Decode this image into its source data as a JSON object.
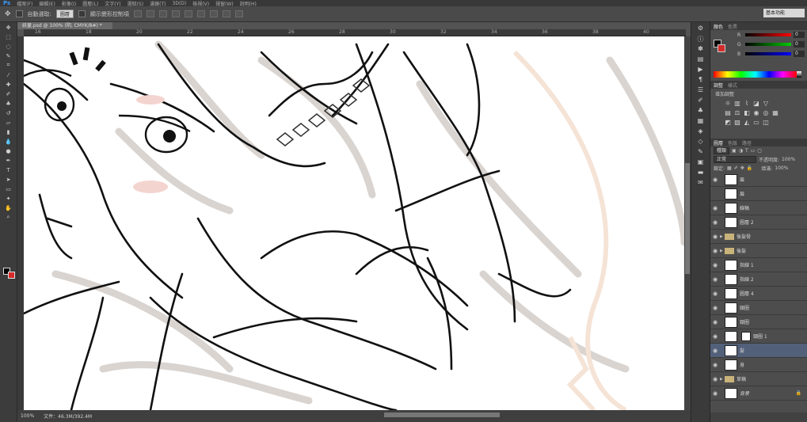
{
  "app": {
    "logo": "Ps"
  },
  "menu": [
    "檔案(F)",
    "編輯(E)",
    "影像(I)",
    "圖層(L)",
    "文字(Y)",
    "選取(S)",
    "濾鏡(T)",
    "3D(D)",
    "檢視(V)",
    "視窗(W)",
    "說明(H)"
  ],
  "options": {
    "auto_select_label": "自動選取:",
    "auto_select_value": "圖層",
    "transform_label": "顯示變形控制項"
  },
  "workspace": {
    "value": "基本功能"
  },
  "document": {
    "tab_title": "妖童.psd @ 100% (阴, CMYK/8#) *",
    "zoom": "100%",
    "status": "文件：46.3M/392.4M"
  },
  "ruler": {
    "labels": [
      "16",
      "18",
      "20",
      "22",
      "24",
      "26",
      "28",
      "30",
      "32",
      "34",
      "36",
      "38",
      "40",
      "42"
    ]
  },
  "color_panel": {
    "tabs": [
      "顏色",
      "色票"
    ],
    "channels": [
      {
        "label": "R",
        "value": "0"
      },
      {
        "label": "G",
        "value": "0"
      },
      {
        "label": "B",
        "value": "0"
      }
    ]
  },
  "adjust_panel": {
    "tabs": [
      "調整",
      "樣式"
    ],
    "title": "增加調整"
  },
  "layers_panel": {
    "tabs": [
      "圖層",
      "色版",
      "路徑"
    ],
    "filter_kind": "種類",
    "blend_mode": "正常",
    "opacity_label": "不透明度:",
    "opacity_value": "100%",
    "lock_label": "鎖定:",
    "fill_label": "填滿:",
    "fill_value": "100%",
    "layers": [
      {
        "name": "眉",
        "kind": "layer"
      },
      {
        "name": "眉",
        "kind": "layer"
      },
      {
        "name": "線稿",
        "kind": "layer"
      },
      {
        "name": "圖層 2",
        "kind": "layer"
      },
      {
        "name": "後髮骨",
        "kind": "group"
      },
      {
        "name": "後髮",
        "kind": "group"
      },
      {
        "name": "指線 1",
        "kind": "layer"
      },
      {
        "name": "指線 2",
        "kind": "layer"
      },
      {
        "name": "圖層 4",
        "kind": "layer"
      },
      {
        "name": "頸圈",
        "kind": "layer"
      },
      {
        "name": "頸圈",
        "kind": "layer"
      },
      {
        "name": "頸圈 1",
        "kind": "masked"
      },
      {
        "name": "髮",
        "kind": "layer",
        "selected": true
      },
      {
        "name": "身",
        "kind": "layer"
      },
      {
        "name": "草稿",
        "kind": "group"
      },
      {
        "name": "背景",
        "kind": "background"
      }
    ]
  }
}
